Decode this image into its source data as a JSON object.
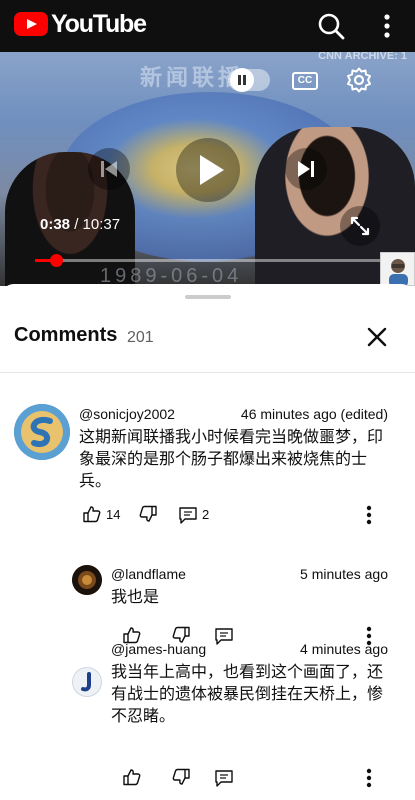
{
  "header": {
    "logo_text": "YouTube",
    "search_icon": "search-icon",
    "more_icon": "more-vertical-icon"
  },
  "player": {
    "current_time": "0:38",
    "separator": " / ",
    "duration": "10:37",
    "progress_fraction": 0.061,
    "cc_label": "CC",
    "overlay_channel": "CNN ARCHIVE: 1",
    "overlay_title": "新闻联播",
    "overlay_date": "1989-06-04"
  },
  "comments_panel": {
    "title": "Comments",
    "count": "201",
    "comments": [
      {
        "handle": "@sonicjoy2002",
        "time": "46 minutes ago (edited)",
        "lines": [
          "这期新闻联播我小时候看完当晚做噩梦，印",
          "象最深的是那个肠子都爆出来被烧焦的士",
          "兵。"
        ],
        "likes": "14",
        "replies": "2"
      },
      {
        "handle": "@landflame",
        "time": "5 minutes ago",
        "lines": [
          "我也是"
        ]
      },
      {
        "handle": "@james-huang",
        "time": "4 minutes ago",
        "lines": [
          "我当年上高中，也看到这个画面了，还",
          "有战士的遗体被暴民倒挂在天桥上，惨",
          "不忍睹。"
        ]
      }
    ]
  },
  "colors": {
    "accent": "#ff0000",
    "topbar": "#0f0f0f",
    "text": "#0f0f0f",
    "muted": "#606060"
  }
}
